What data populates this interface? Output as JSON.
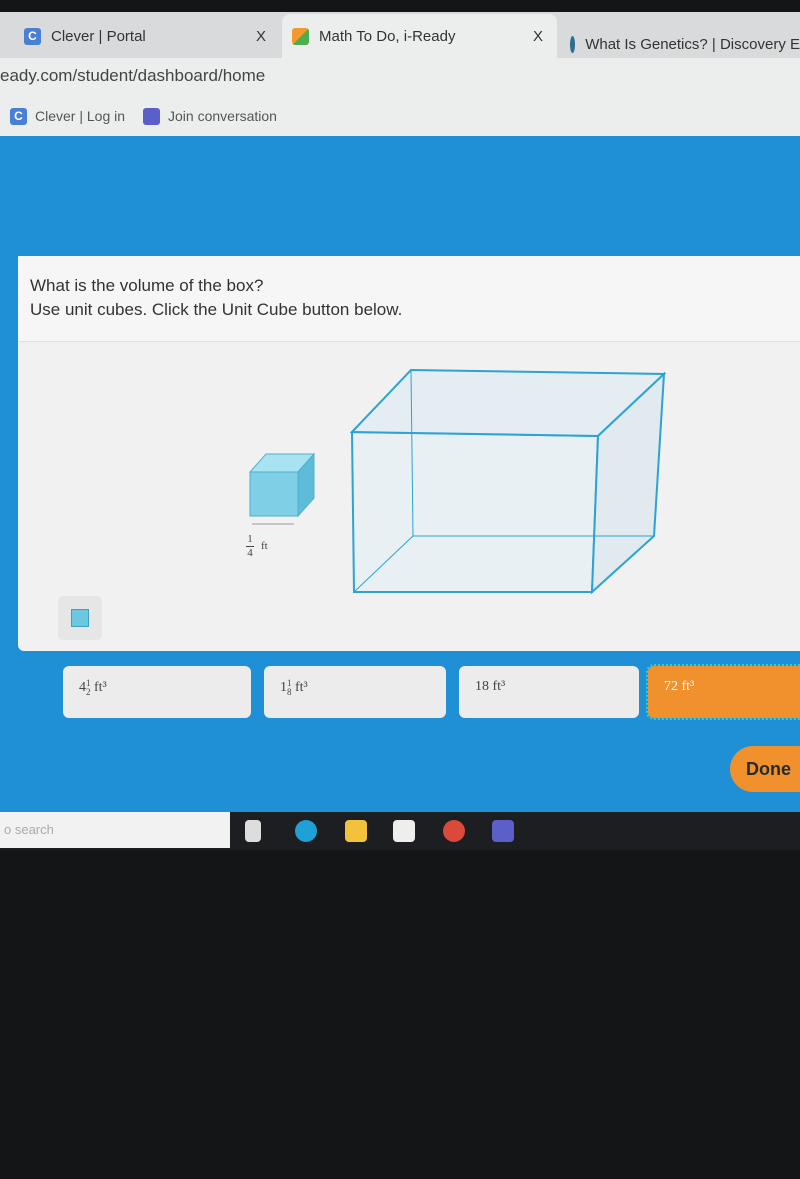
{
  "browser": {
    "tabs": [
      {
        "title": "Clever | Portal",
        "icon": "clever-icon"
      },
      {
        "title": "Math To Do, i-Ready",
        "icon": "iready-cube-icon",
        "active": true
      },
      {
        "title": "What Is Genetics? | Discovery E",
        "icon": "discovery-globe-icon"
      }
    ],
    "close_glyph": "X",
    "url": "eady.com/student/dashboard/home",
    "bookmarks": [
      {
        "label": "Clever | Log in",
        "icon": "clever-icon"
      },
      {
        "label": "Join conversation",
        "icon": "teams-icon"
      }
    ]
  },
  "question": {
    "line1": "What is the volume of the box?",
    "line2": "Use unit cubes. Click the Unit Cube button below.",
    "unit_cube_label": {
      "numerator": "1",
      "denominator": "4",
      "unit": "ft"
    }
  },
  "answers": [
    {
      "whole": "4",
      "num": "1",
      "den": "2",
      "unit": "ft³"
    },
    {
      "whole": "1",
      "num": "1",
      "den": "8",
      "unit": "ft³"
    },
    {
      "label": "18 ft³"
    },
    {
      "label": "72 ft³",
      "selected": true
    }
  ],
  "done_label": "Done",
  "taskbar": {
    "search_placeholder": "o search",
    "icons": [
      "task-view-icon",
      "edge-icon",
      "file-explorer-icon",
      "store-icon",
      "chrome-icon",
      "teams-icon"
    ]
  },
  "colors": {
    "accent_blue": "#1f8fd6",
    "selected_orange": "#f0912e",
    "cube": "#7fd0e6"
  }
}
